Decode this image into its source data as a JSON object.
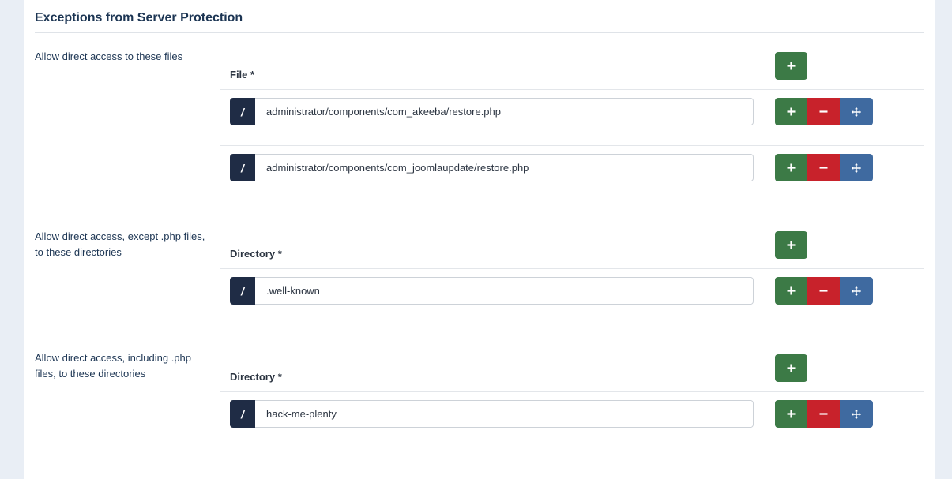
{
  "fieldset": {
    "title": "Exceptions from Server Protection"
  },
  "icons": {
    "add": "plus-icon",
    "remove": "minus-icon",
    "move": "move-arrows-icon"
  },
  "colors": {
    "add": "#3c7a46",
    "remove": "#c8222b",
    "move": "#3f6aa0",
    "addon": "#1f2c45"
  },
  "groups": [
    {
      "label": "Allow direct access to these files",
      "column_header": "File *",
      "rows": [
        {
          "prefix": "/",
          "value": "administrator/components/com_akeeba/restore.php"
        },
        {
          "prefix": "/",
          "value": "administrator/components/com_joomlaupdate/restore.php"
        }
      ]
    },
    {
      "label": "Allow direct access, except .php files, to these directories",
      "column_header": "Directory *",
      "rows": [
        {
          "prefix": "/",
          "value": ".well-known"
        }
      ]
    },
    {
      "label": "Allow direct access, including .php files, to these directories",
      "column_header": "Directory *",
      "rows": [
        {
          "prefix": "/",
          "value": "hack-me-plenty"
        }
      ]
    }
  ]
}
